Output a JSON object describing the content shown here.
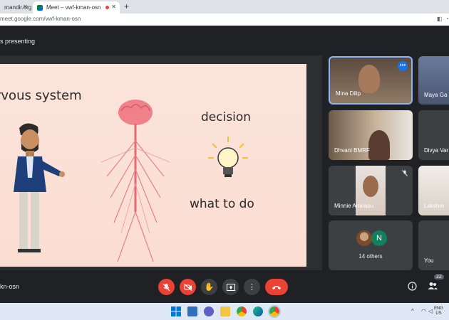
{
  "browser": {
    "tabs": [
      {
        "label": "rnandir.org"
      },
      {
        "label": "Meet – vwf-kman-osn",
        "recording": true
      }
    ],
    "url": "meet.google.com/vwf-kman-osn"
  },
  "meet": {
    "presenting_label": "s presenting",
    "meeting_code": "kn-osn",
    "participant_badge": "22"
  },
  "slide": {
    "title": "rvous system",
    "word1": "decision",
    "word2": "what to do"
  },
  "participants": [
    {
      "name": "Mina Dilip",
      "speaking": true
    },
    {
      "name": "Maya Ga"
    },
    {
      "name": "Dhvani BMRF"
    },
    {
      "name": "Divya Var"
    },
    {
      "name": "Minnie Amirapu",
      "muted": true
    },
    {
      "name": "Lakshm"
    },
    {
      "name": "14 others",
      "avatar_letter": "N"
    },
    {
      "name": "You"
    }
  ],
  "taskbar": {
    "language": "ENG",
    "region": "US"
  },
  "colors": {
    "accent": "#8ab4f8",
    "danger": "#ea4335",
    "bg": "#202124"
  }
}
